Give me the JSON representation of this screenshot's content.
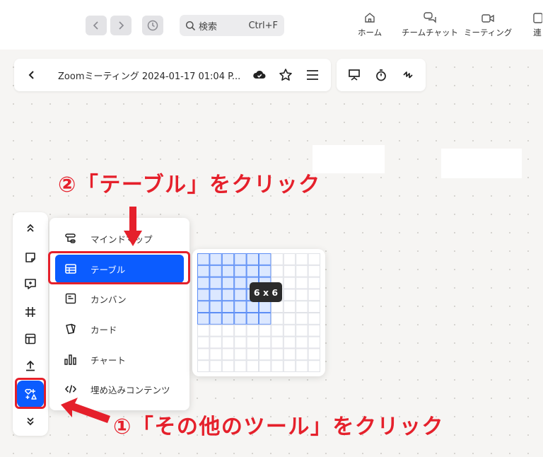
{
  "topbar": {
    "search_placeholder": "検索",
    "search_shortcut": "Ctrl+F",
    "nav": [
      {
        "label": "ホーム",
        "icon": "home-icon"
      },
      {
        "label": "チームチャット",
        "icon": "chat-icon"
      },
      {
        "label": "ミーティング",
        "icon": "video-icon"
      },
      {
        "label": "連",
        "icon": "contacts-icon"
      }
    ]
  },
  "doc": {
    "title": "Zoomミーティング 2024-01-17 01:04 P..."
  },
  "menu": {
    "items": [
      {
        "label": "マインドマップ",
        "icon": "mindmap-icon"
      },
      {
        "label": "テーブル",
        "icon": "table-icon"
      },
      {
        "label": "カンバン",
        "icon": "kanban-icon"
      },
      {
        "label": "カード",
        "icon": "card-icon"
      },
      {
        "label": "チャート",
        "icon": "chart-icon"
      },
      {
        "label": "埋め込みコンテンツ",
        "icon": "embed-icon"
      }
    ],
    "selected": "テーブル"
  },
  "table_picker": {
    "size_label": "6 x 6",
    "selected_rows": 6,
    "selected_cols": 6,
    "total_rows": 10,
    "total_cols": 10
  },
  "annotations": {
    "step1": "①「その他のツール」をクリック",
    "step2": "②「テーブル」をクリック"
  },
  "colors": {
    "accent": "#0b5cff",
    "annotation": "#e5202b"
  }
}
